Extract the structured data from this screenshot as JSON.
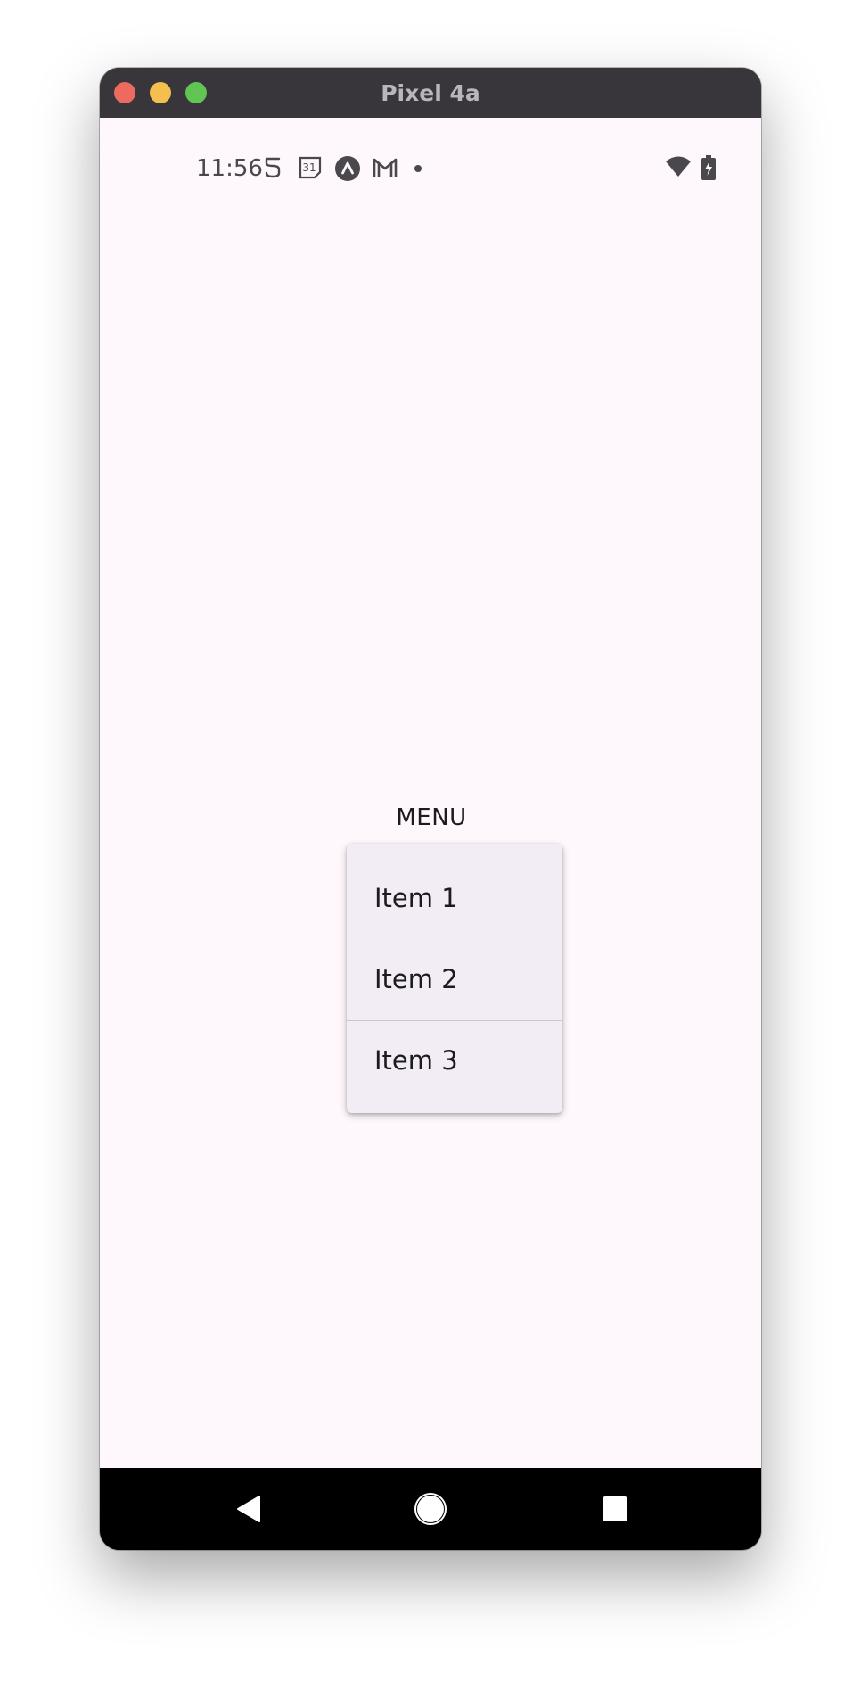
{
  "window": {
    "title": "Pixel 4a"
  },
  "statusbar": {
    "time": "11:56",
    "notification_icons": [
      "mobile-data-icon",
      "calendar-icon",
      "app-notification-icon",
      "gmail-icon",
      "more-notifications-dot-icon"
    ],
    "calendar_day": "31",
    "system_icons": [
      "wifi-icon",
      "battery-charging-icon"
    ]
  },
  "menu": {
    "trigger_label": "MENU",
    "items": [
      {
        "label": "Item 1"
      },
      {
        "label": "Item 2"
      },
      {
        "label": "Item 3"
      }
    ]
  },
  "navbar": {
    "buttons": [
      "back-icon",
      "home-icon",
      "recents-icon"
    ]
  },
  "colors": {
    "screen_background": "#fef7fb",
    "menu_surface": "#f2ecf5",
    "text_primary": "#1d1b20",
    "titlebar": "#38363b"
  }
}
